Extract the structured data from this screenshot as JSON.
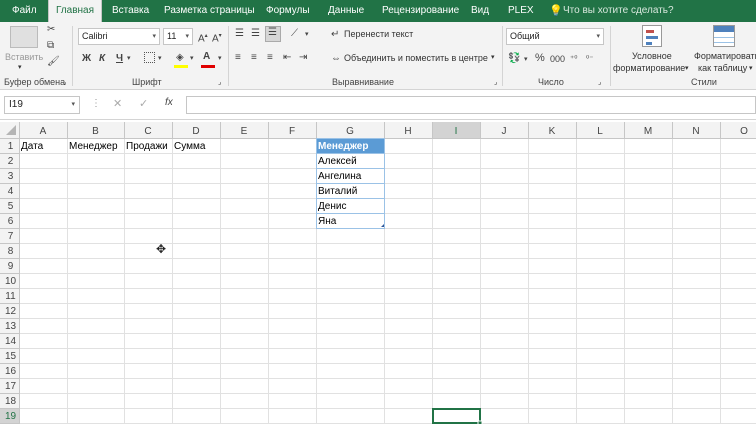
{
  "tabs": [
    "Файл",
    "Главная",
    "Вставка",
    "Разметка страницы",
    "Формулы",
    "Данные",
    "Рецензирование",
    "Вид",
    "PLEX"
  ],
  "tell_me": "Что вы хотите сделать?",
  "ribbon": {
    "paste_label": "Вставить",
    "clipboard_label": "Буфер обмена",
    "font_name": "Calibri",
    "font_size": "11",
    "font_group_label": "Шрифт",
    "bold": "Ж",
    "italic": "К",
    "underline": "Ч",
    "wrap_text": "Перенести текст",
    "merge_center": "Объединить и поместить в центре",
    "alignment_label": "Выравнивание",
    "number_format": "Общий",
    "number_label": "Число",
    "percent": "%",
    "thousands": "000",
    "cond_format_1": "Условное",
    "cond_format_2": "форматирование",
    "format_table_1": "Форматировать",
    "format_table_2": "как таблицу",
    "styles_label": "Стили"
  },
  "formula_bar": {
    "name_box": "I19",
    "fx": "fx",
    "formula": ""
  },
  "columns": [
    "A",
    "B",
    "C",
    "D",
    "E",
    "F",
    "G",
    "H",
    "I",
    "J",
    "K",
    "L",
    "M",
    "N",
    "O"
  ],
  "rows": [
    "1",
    "2",
    "3",
    "4",
    "5",
    "6",
    "7",
    "8",
    "9",
    "10",
    "11",
    "12",
    "13",
    "14",
    "15",
    "16",
    "17",
    "18",
    "19"
  ],
  "selected_cell": "I19",
  "cells": {
    "A1": "Дата",
    "B1": "Менеджер",
    "C1": "Продажи",
    "D1": "Сумма",
    "G1": "Менеджер",
    "G2": "Алексей",
    "G3": "Ангелина",
    "G4": "Виталий",
    "G5": "Денис",
    "G6": "Яна"
  },
  "colors": {
    "excel_green": "#217346",
    "table_header": "#5b9bd5",
    "table_border": "#9bc2e6",
    "selection": "#217346"
  }
}
